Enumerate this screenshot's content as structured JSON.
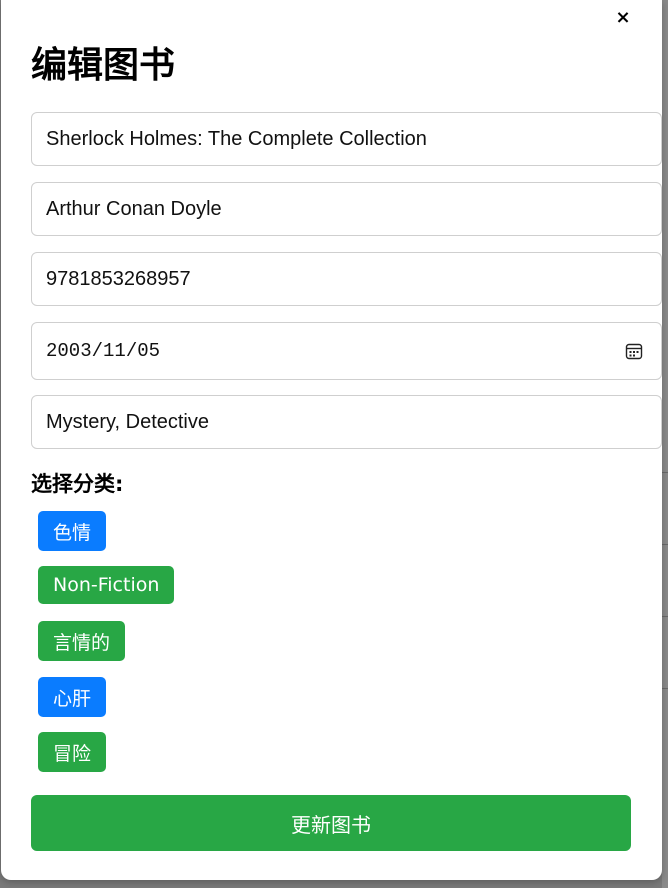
{
  "modal": {
    "title": "编辑图书",
    "close_label": "×"
  },
  "form": {
    "title_value": "Sherlock Holmes: The Complete Collection",
    "author_value": "Arthur Conan Doyle",
    "isbn_value": "9781853268957",
    "date_value": "2003/11/05",
    "genre_value": "Mystery, Detective"
  },
  "categories": {
    "label": "选择分类:",
    "items": [
      {
        "label": "色情",
        "color": "#0a7cff",
        "selected": false
      },
      {
        "label": "Non-Fiction",
        "color": "#28a745",
        "selected": true
      },
      {
        "label": "言情的",
        "color": "#28a745",
        "selected": true
      },
      {
        "label": "心肝",
        "color": "#0a7cff",
        "selected": false
      },
      {
        "label": "冒险",
        "color": "#28a745",
        "selected": true
      }
    ]
  },
  "submit": {
    "label": "更新图书",
    "color": "#28a745"
  },
  "icons": {
    "close": "close-icon",
    "calendar": "calendar-icon"
  }
}
